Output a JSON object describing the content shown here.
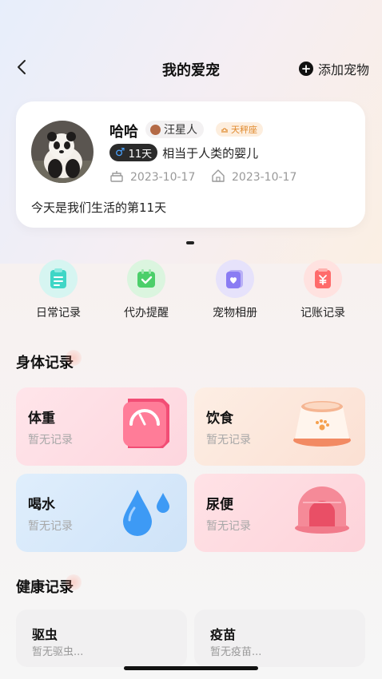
{
  "header": {
    "title": "我的爱宠",
    "add_label": "添加宠物",
    "add_icon": "plus-circle-icon",
    "back_icon": "chevron-left-icon"
  },
  "pet": {
    "name": "哈哈",
    "breed": "汪星人",
    "zodiac": "天秤座",
    "gender_symbol": "♂",
    "age": "11天",
    "age_desc": "相当于人类的婴儿",
    "birth_date": "2023-10-17",
    "home_date": "2023-10-17",
    "together_text": "今天是我们生活的第11天"
  },
  "quick_actions": [
    {
      "label": "日常记录",
      "icon": "clipboard-icon",
      "color": "#3fd6c6"
    },
    {
      "label": "代办提醒",
      "icon": "calendar-check-icon",
      "color": "#4ccf6a"
    },
    {
      "label": "宠物相册",
      "icon": "photo-album-icon",
      "color": "#8a7cf3"
    },
    {
      "label": "记账记录",
      "icon": "ledger-icon",
      "color": "#ff6b6b"
    }
  ],
  "body_records": {
    "title": "身体记录",
    "items": [
      {
        "title": "体重",
        "sub": "暂无记录",
        "icon": "scale-icon"
      },
      {
        "title": "饮食",
        "sub": "暂无记录",
        "icon": "food-bowl-icon"
      },
      {
        "title": "喝水",
        "sub": "暂无记录",
        "icon": "water-drop-icon"
      },
      {
        "title": "尿便",
        "sub": "暂无记录",
        "icon": "litter-box-icon"
      }
    ]
  },
  "health_records": {
    "title": "健康记录",
    "items": [
      {
        "title": "驱虫",
        "sub": "暂无驱虫..."
      },
      {
        "title": "疫苗",
        "sub": "暂无疫苗..."
      }
    ]
  }
}
